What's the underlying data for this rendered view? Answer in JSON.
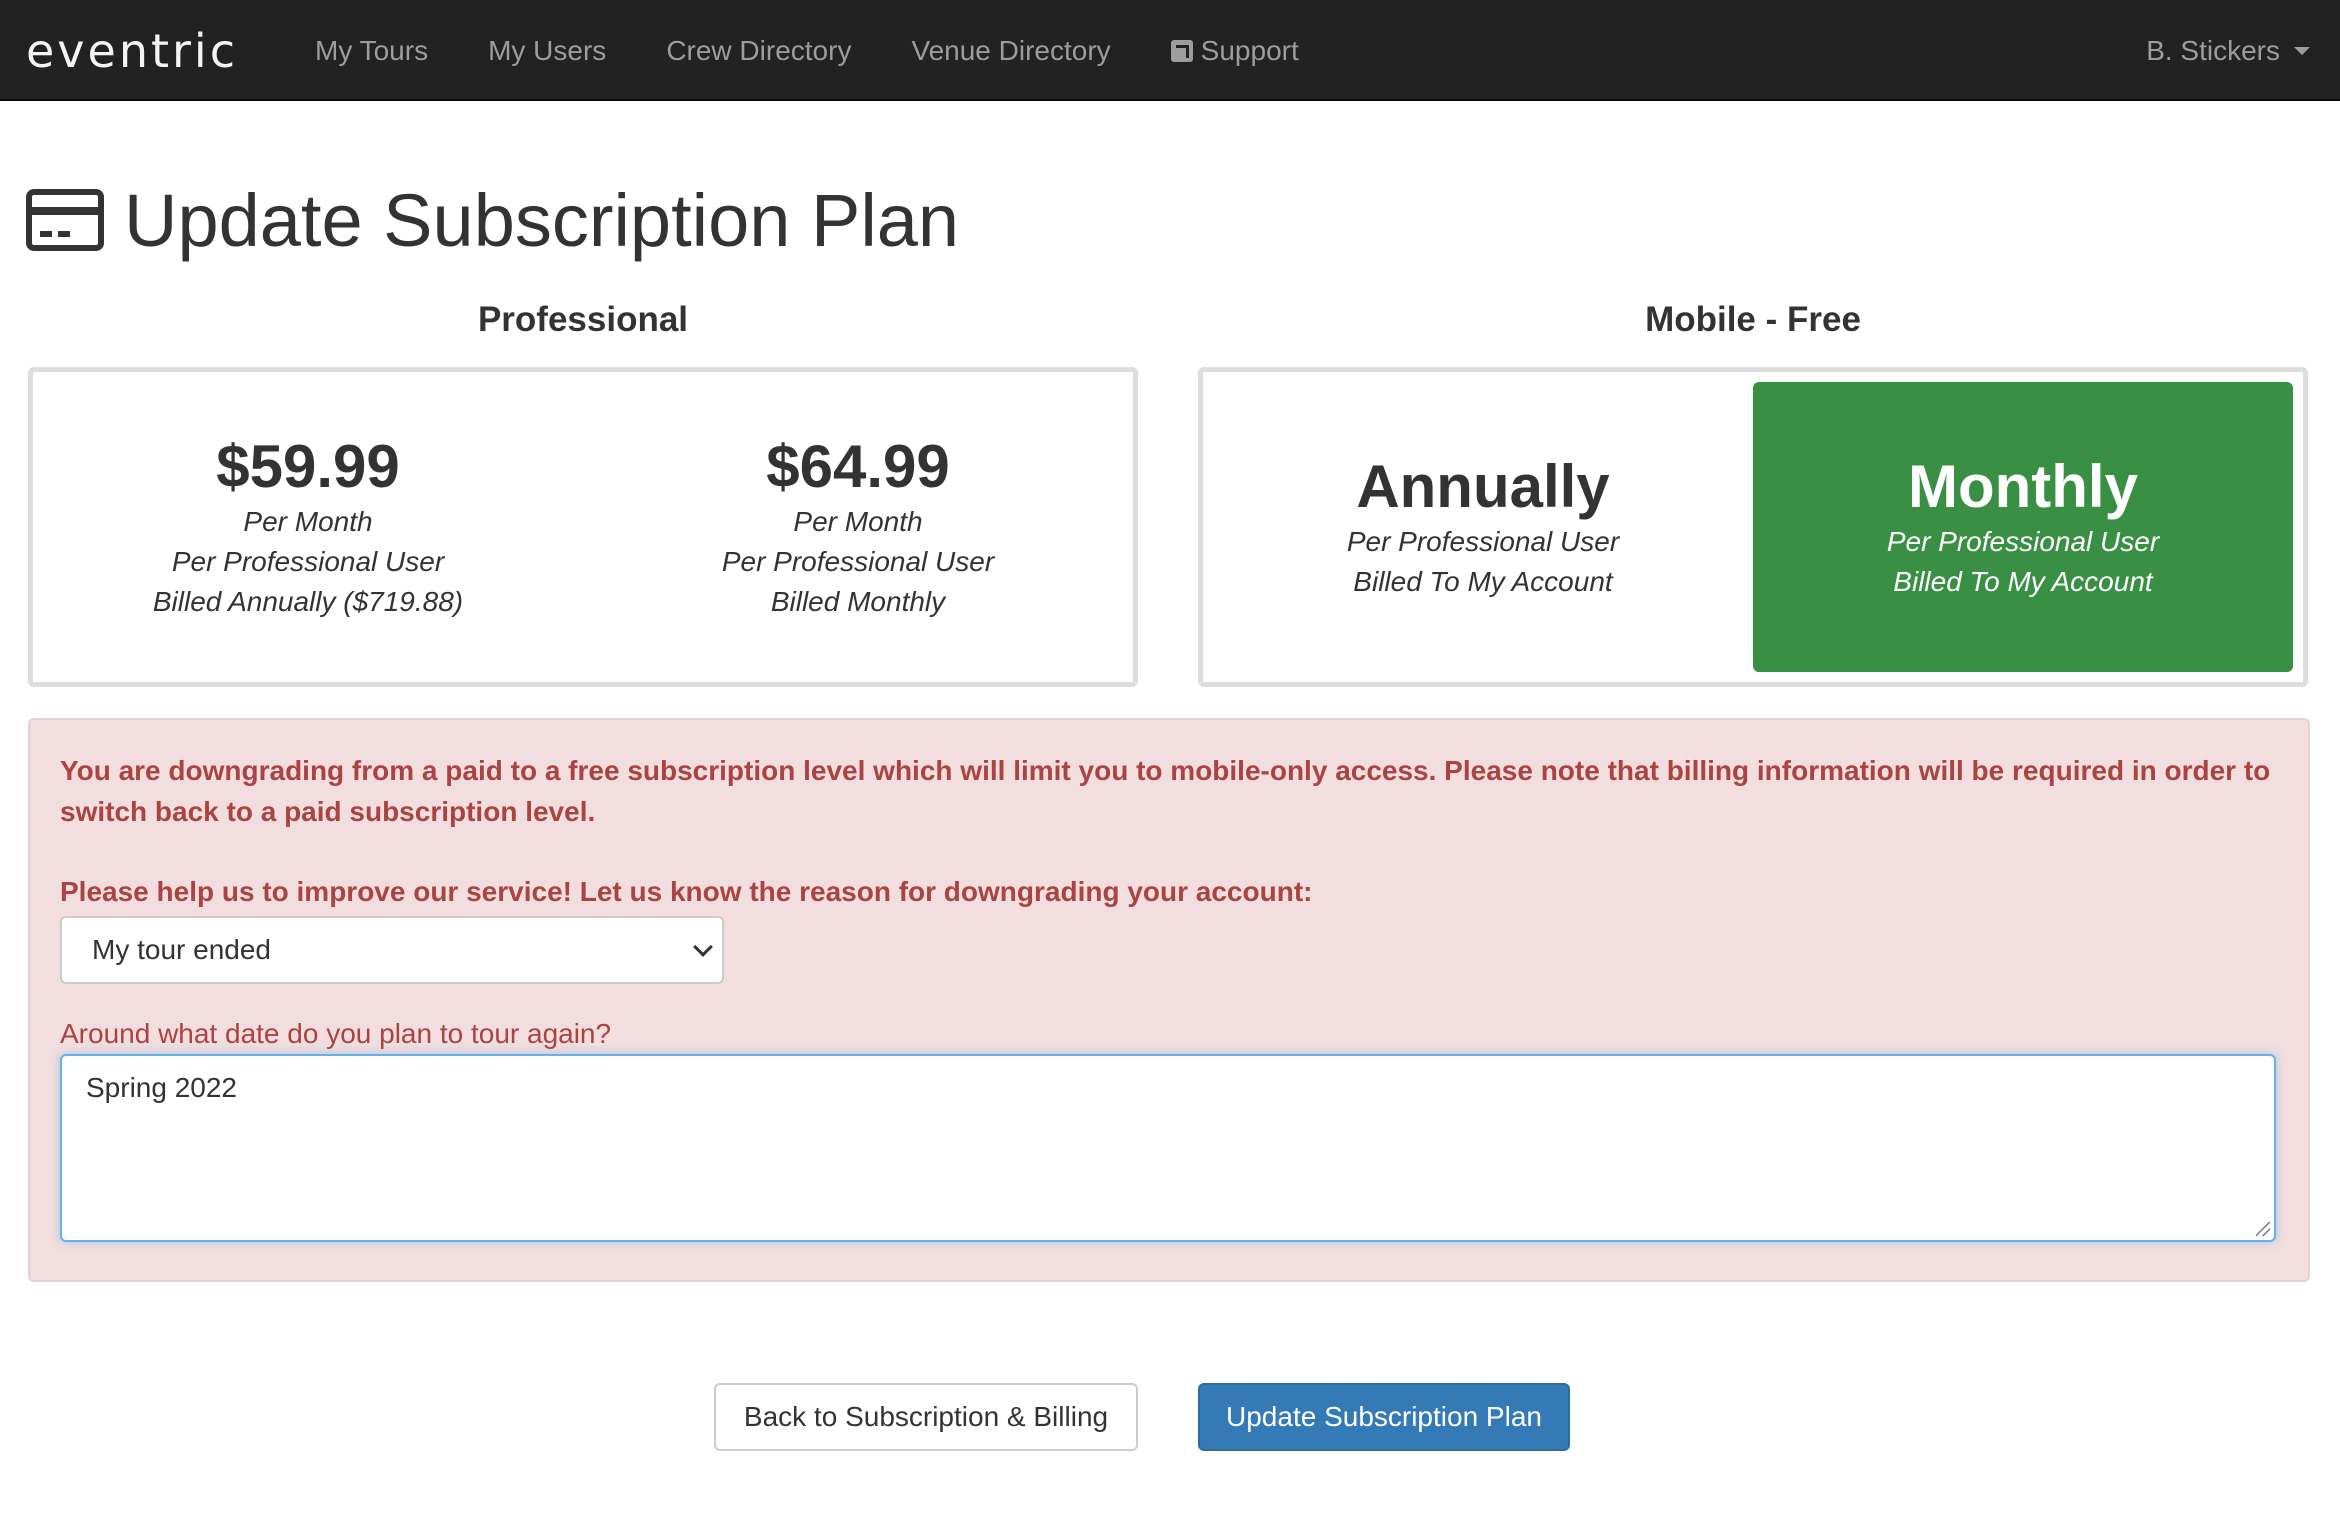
{
  "navbar": {
    "logo": "eventric",
    "links": [
      "My Tours",
      "My Users",
      "Crew Directory",
      "Venue Directory",
      "Support"
    ],
    "user": "B. Stickers"
  },
  "page": {
    "title": "Update Subscription Plan"
  },
  "plans": {
    "professional": {
      "heading": "Professional",
      "annual": {
        "price": "$59.99",
        "line1": "Per Month",
        "line2": "Per Professional User",
        "line3": "Billed Annually ($719.88)"
      },
      "monthly": {
        "price": "$64.99",
        "line1": "Per Month",
        "line2": "Per Professional User",
        "line3": "Billed Monthly"
      }
    },
    "mobile": {
      "heading": "Mobile - Free",
      "annual": {
        "title": "Annually",
        "line1": "Per Professional User",
        "line2": "Billed To My Account"
      },
      "monthly": {
        "title": "Monthly",
        "line1": "Per Professional User",
        "line2": "Billed To My Account",
        "selected": true
      }
    }
  },
  "alert": {
    "message": "You are downgrading from a paid to a free subscription level which will limit you to mobile-only access. Please note that billing information will be required in order to switch back to a paid subscription level.",
    "reason_label": "Please help us to improve our service! Let us know the reason for downgrading your account:",
    "reason_value": "My tour ended",
    "date_label": "Around what date do you plan to tour again?",
    "date_value": "Spring 2022"
  },
  "buttons": {
    "back": "Back to Subscription & Billing",
    "update": "Update Subscription Plan"
  },
  "colors": {
    "navbar": "#222222",
    "selected_plan": "#398f43",
    "alert_bg": "#f2dede",
    "alert_text": "#a94442",
    "primary": "#337ab7"
  }
}
